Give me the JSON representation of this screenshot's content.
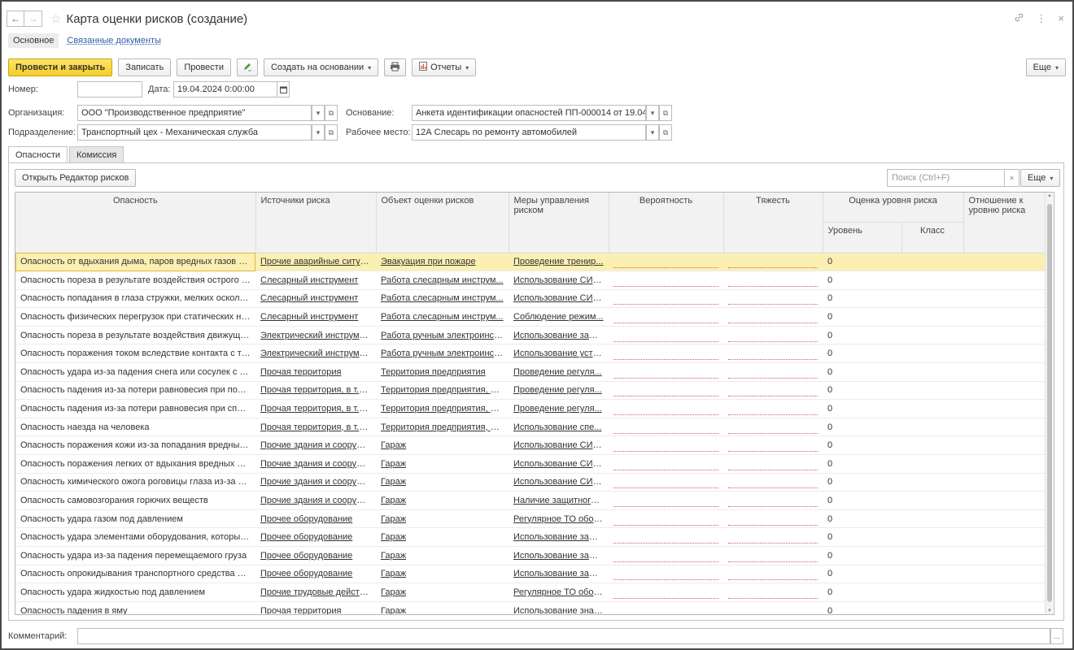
{
  "window": {
    "title": "Карта оценки рисков (создание)",
    "back_glyph": "←",
    "forward_glyph": "→",
    "star_glyph": "☆",
    "link_glyph": "🔗",
    "menu_glyph": "⋮",
    "close_glyph": "×"
  },
  "top_tabs": {
    "main": "Основное",
    "related": "Связанные документы"
  },
  "toolbar": {
    "post_close": "Провести и закрыть",
    "save": "Записать",
    "post": "Провести",
    "create_based": "Создать на основании",
    "reports": "Отчеты",
    "more": "Еще",
    "caret": "▾"
  },
  "form": {
    "number_label": "Номер:",
    "number_value": "",
    "date_label": "Дата:",
    "date_value": "19.04.2024  0:00:00",
    "org_label": "Организация:",
    "org_value": "ООО \"Производственное предприятие\"",
    "basis_label": "Основание:",
    "basis_value": "Анкета идентификации опасностей ПП-000014 от 19.04.2(",
    "division_label": "Подразделение:",
    "division_value": "Транспортный цех - Механическая служба",
    "workplace_label": "Рабочее место:",
    "workplace_value": "12А Слесарь по ремонту автомобилей"
  },
  "inner_tabs": {
    "hazards": "Опасности",
    "commission": "Комиссия"
  },
  "panel": {
    "open_editor": "Открыть Редактор рисков",
    "search_placeholder": "Поиск (Ctrl+F)",
    "search_clear": "×",
    "more": "Еще"
  },
  "table": {
    "headers": {
      "hazard": "Опасность",
      "sources": "Источники риска",
      "object": "Объект оценки рисков",
      "measures": "Меры управления риском",
      "probability": "Вероятность",
      "severity": "Тяжесть",
      "assessment": "Оценка уровня риска",
      "level": "Уровень",
      "class": "Класс",
      "attitude": "Отношение к уровню риска"
    },
    "rows": [
      {
        "hazard": "Опасность от вдыхания дыма, паров вредных газов и п...",
        "source": "Прочие аварийные ситуа...",
        "object": "Эвакуация при пожаре",
        "measure": "Проведение тренир...",
        "level": "0"
      },
      {
        "hazard": "Опасность пореза в результате воздействия острого ре...",
        "source": "Слесарный инструмент",
        "object": "Работа слесарным инструм...",
        "measure": "Использование СИЗ...",
        "level": "0"
      },
      {
        "hazard": "Опасность попадания в глаза стружки, мелких осколков",
        "source": "Слесарный инструмент",
        "object": "Работа слесарным инструм...",
        "measure": "Использование СИЗ...",
        "level": "0"
      },
      {
        "hazard": "Опасность физических перегрузок при статических наг...",
        "source": "Слесарный инструмент",
        "object": "Работа слесарным инструм...",
        "measure": "Соблюдение режим...",
        "level": "0"
      },
      {
        "hazard": "Опасность пореза в результате воздействия движущих...",
        "source": "Электрический инструмент",
        "object": "Работа ручным электроинст...",
        "measure": "Использование защ...",
        "level": "0"
      },
      {
        "hazard": "Опасность поражения током вследствие контакта с ток...",
        "source": "Электрический инструмент",
        "object": "Работа ручным электроинст...",
        "measure": "Использование устр...",
        "level": "0"
      },
      {
        "hazard": "Опасность удара из-за падения снега или сосулек с кр...",
        "source": "Прочая территория",
        "object": "Территория предприятия",
        "measure": "Проведение регуля...",
        "level": "0"
      },
      {
        "hazard": "Опасность падения из-за потери равновесия при подск...",
        "source": "Прочая территория, в т.ч. ...",
        "object": "Территория предприятия, в т...",
        "measure": "Проведение регуля...",
        "level": "0"
      },
      {
        "hazard": "Опасность падения из-за потери равновесия при споты...",
        "source": "Прочая территория, в т.ч. ...",
        "object": "Территория предприятия, в т...",
        "measure": "Проведение регуля...",
        "level": "0"
      },
      {
        "hazard": "Опасность наезда на человека",
        "source": "Прочая территория, в т.ч. ...",
        "object": "Территория предприятия, в т...",
        "measure": "Использование спе...",
        "level": "0"
      },
      {
        "hazard": "Опасность поражения кожи из-за попадания вредных в...",
        "source": "Прочие здания и сооруже...",
        "object": "Гараж",
        "measure": "Использование СИЗ...",
        "level": "0"
      },
      {
        "hazard": "Опасность поражения легких от вдыхания вредных пар...",
        "source": "Прочие здания и сооруже...",
        "object": "Гараж",
        "measure": "Использование СИЗ...",
        "level": "0"
      },
      {
        "hazard": "Опасность химического ожога роговицы глаза из-за поп...",
        "source": "Прочие здания и сооруже...",
        "object": "Гараж",
        "measure": "Использование СИЗ...",
        "level": "0"
      },
      {
        "hazard": "Опасность самовозгорания горючих веществ",
        "source": "Прочие здания и сооруже...",
        "object": "Гараж",
        "measure": "Наличие защитного ...",
        "level": "0"
      },
      {
        "hazard": "Опасность удара газом под давлением",
        "source": "Прочее оборудование",
        "object": "Гараж",
        "measure": "Регулярное ТО обор...",
        "level": "0"
      },
      {
        "hazard": "Опасность удара элементами оборудования, которые ...",
        "source": "Прочее оборудование",
        "object": "Гараж",
        "measure": "Использование защ...",
        "level": "0"
      },
      {
        "hazard": "Опасность удара из-за падения перемещаемого груза",
        "source": "Прочее оборудование",
        "object": "Гараж",
        "measure": "Использование защ...",
        "level": "0"
      },
      {
        "hazard": "Опасность опрокидывания транспортного средства при...",
        "source": "Прочее оборудование",
        "object": "Гараж",
        "measure": "Использование защ...",
        "level": "0"
      },
      {
        "hazard": "Опасность удара жидкостью под давлением",
        "source": "Прочие трудовые действия",
        "object": "Гараж",
        "measure": "Регулярное ТО обор...",
        "level": "0"
      },
      {
        "hazard": "Опасность падения в яму",
        "source": "Прочая территория",
        "object": "Гараж",
        "measure": "Использование знак...",
        "level": "0"
      }
    ]
  },
  "comment": {
    "label": "Комментарий:",
    "value": "",
    "dots": "..."
  }
}
